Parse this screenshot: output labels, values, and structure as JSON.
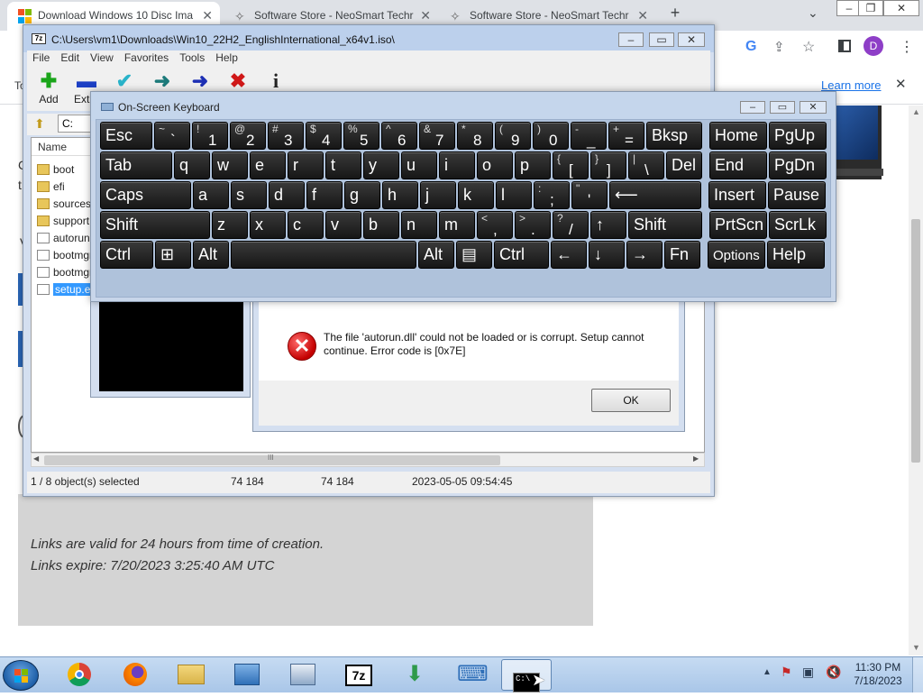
{
  "browser": {
    "tabs": [
      {
        "title": "Download Windows 10 Disc Ima",
        "active": true
      },
      {
        "title": "Software Store - NeoSmart Techr",
        "active": false
      },
      {
        "title": "Software Store - NeoSmart Techr",
        "active": false
      }
    ],
    "close_glyph": "✕",
    "new_tab_glyph": "+",
    "tab_search_glyph": "⌄",
    "profile_initial": "D",
    "infobar_link": "Learn more",
    "infobar_close": "✕",
    "infobar_text_fragment": "To",
    "page_fragments": [
      "C",
      "t",
      "V"
    ],
    "links_valid": "Links are valid for 24 hours from time of creation.",
    "links_expire": "Links expire: 7/20/2023 3:25:40 AM UTC"
  },
  "sevenzip": {
    "title": "C:\\Users\\vm1\\Downloads\\Win10_22H2_EnglishInternational_x64v1.iso\\",
    "app_icon": "7z",
    "menu": [
      "File",
      "Edit",
      "View",
      "Favorites",
      "Tools",
      "Help"
    ],
    "toolbar": [
      {
        "label": "Add",
        "icon": "plus-icon",
        "glyph": "✚",
        "color": "#1aa51a"
      },
      {
        "label": "Extra",
        "icon": "minus-icon",
        "glyph": "▬",
        "color": "#1c3fc4"
      },
      {
        "label": "",
        "icon": "check-icon",
        "glyph": "✔",
        "color": "#29b3c9"
      },
      {
        "label": "",
        "icon": "copy-arrow-icon",
        "glyph": "➜",
        "color": "#1c7a7a"
      },
      {
        "label": "",
        "icon": "move-arrow-icon",
        "glyph": "➜",
        "color": "#1c2fb4"
      },
      {
        "label": "",
        "icon": "delete-x-icon",
        "glyph": "✖",
        "color": "#d01818"
      },
      {
        "label": "",
        "icon": "info-icon",
        "glyph": "i",
        "color": "#222222"
      }
    ],
    "address_fragment": "C:",
    "column_name": "Name",
    "files": [
      {
        "name": "boot",
        "type": "folder"
      },
      {
        "name": "efi",
        "type": "folder"
      },
      {
        "name": "sources",
        "type": "folder"
      },
      {
        "name": "support",
        "type": "folder"
      },
      {
        "name": "autorun",
        "type": "file"
      },
      {
        "name": "bootmgr",
        "type": "file"
      },
      {
        "name": "bootmgr",
        "type": "file"
      },
      {
        "name": "setup.exe",
        "type": "file",
        "selected": true
      }
    ],
    "status": {
      "selected": "1 / 8 object(s) selected",
      "size": "74 184",
      "packed": "74 184",
      "modified": "2023-05-05 09:54:45"
    },
    "hscroll_glyph": "III"
  },
  "osk": {
    "title": "On-Screen Keyboard",
    "rows": [
      [
        {
          "label": "Esc",
          "w": 58
        },
        {
          "top": "~",
          "bottom": "`",
          "w": 40
        },
        {
          "top": "!",
          "bottom": "1",
          "w": 40
        },
        {
          "top": "@",
          "bottom": "2",
          "w": 40
        },
        {
          "top": "#",
          "bottom": "3",
          "w": 40
        },
        {
          "top": "$",
          "bottom": "4",
          "w": 40
        },
        {
          "top": "%",
          "bottom": "5",
          "w": 40
        },
        {
          "top": "^",
          "bottom": "6",
          "w": 40
        },
        {
          "top": "&",
          "bottom": "7",
          "w": 40
        },
        {
          "top": "*",
          "bottom": "8",
          "w": 40
        },
        {
          "top": "(",
          "bottom": "9",
          "w": 40
        },
        {
          "top": ")",
          "bottom": "0",
          "w": 40
        },
        {
          "top": "-",
          "bottom": "_",
          "w": 40
        },
        {
          "top": "+",
          "bottom": "=",
          "w": 40
        },
        {
          "label": "Bksp",
          "w": 62
        },
        {
          "label": "Home",
          "w": 64,
          "gap": 6
        },
        {
          "label": "PgUp",
          "w": 64
        }
      ],
      [
        {
          "label": "Tab",
          "w": 80
        },
        {
          "label": "q",
          "w": 40
        },
        {
          "label": "w",
          "w": 40
        },
        {
          "label": "e",
          "w": 40
        },
        {
          "label": "r",
          "w": 40
        },
        {
          "label": "t",
          "w": 40
        },
        {
          "label": "y",
          "w": 40
        },
        {
          "label": "u",
          "w": 40
        },
        {
          "label": "i",
          "w": 40
        },
        {
          "label": "o",
          "w": 40
        },
        {
          "label": "p",
          "w": 40
        },
        {
          "top": "{",
          "bottom": "[",
          "w": 40
        },
        {
          "top": "}",
          "bottom": "]",
          "w": 40
        },
        {
          "top": "|",
          "bottom": "\\",
          "w": 40
        },
        {
          "label": "Del",
          "w": 40
        },
        {
          "label": "End",
          "w": 64,
          "gap": 6
        },
        {
          "label": "PgDn",
          "w": 64
        }
      ],
      [
        {
          "label": "Caps",
          "w": 101
        },
        {
          "label": "a",
          "w": 40
        },
        {
          "label": "s",
          "w": 40
        },
        {
          "label": "d",
          "w": 40
        },
        {
          "label": "f",
          "w": 40
        },
        {
          "label": "g",
          "w": 40
        },
        {
          "label": "h",
          "w": 40
        },
        {
          "label": "j",
          "w": 40
        },
        {
          "label": "k",
          "w": 40
        },
        {
          "label": "l",
          "w": 40
        },
        {
          "top": ":",
          "bottom": ";",
          "w": 40
        },
        {
          "top": "\"",
          "bottom": "'",
          "w": 40
        },
        {
          "label": "⟵",
          "w": 102
        },
        {
          "label": "Insert",
          "w": 64,
          "gap": 6
        },
        {
          "label": "Pause",
          "w": 64
        }
      ],
      [
        {
          "label": "Shift",
          "w": 122
        },
        {
          "label": "z",
          "w": 40
        },
        {
          "label": "x",
          "w": 40
        },
        {
          "label": "c",
          "w": 40
        },
        {
          "label": "v",
          "w": 40
        },
        {
          "label": "b",
          "w": 40
        },
        {
          "label": "n",
          "w": 40
        },
        {
          "label": "m",
          "w": 40
        },
        {
          "top": "<",
          "bottom": ",",
          "w": 40
        },
        {
          "top": ">",
          "bottom": ".",
          "w": 40
        },
        {
          "top": "?",
          "bottom": "/",
          "w": 40
        },
        {
          "label": "↑",
          "w": 40
        },
        {
          "label": "Shift",
          "w": 82
        },
        {
          "label": "PrtScn",
          "w": 64,
          "gap": 6
        },
        {
          "label": "ScrLk",
          "w": 64
        }
      ],
      [
        {
          "label": "Ctrl",
          "w": 59
        },
        {
          "label": "⊞",
          "w": 40
        },
        {
          "label": "Alt",
          "w": 40
        },
        {
          "label": "",
          "w": 206
        },
        {
          "label": "Alt",
          "w": 40
        },
        {
          "label": "▤",
          "w": 40
        },
        {
          "label": "Ctrl",
          "w": 61
        },
        {
          "label": "←",
          "w": 40
        },
        {
          "label": "↓",
          "w": 40
        },
        {
          "label": "→",
          "w": 40
        },
        {
          "label": "Fn",
          "w": 40
        },
        {
          "label": "Options",
          "w": 64,
          "gap": 6,
          "small": true
        },
        {
          "label": "Help",
          "w": 64
        }
      ]
    ]
  },
  "dialog": {
    "message": "The file 'autorun.dll' could not be loaded or is corrupt. Setup cannot continue. Error code is [0x7E]",
    "ok_label": "OK",
    "icon_glyph": "✕"
  },
  "taskbar": {
    "apps": [
      {
        "name": "chrome",
        "glyph": "◉",
        "color": "#d93025"
      },
      {
        "name": "firefox",
        "glyph": "◐",
        "color": "#e66000"
      },
      {
        "name": "explorer",
        "glyph": "▭",
        "color": "#d9b44a"
      },
      {
        "name": "control-panel",
        "glyph": "▦",
        "color": "#2f6fb8"
      },
      {
        "name": "computer-setup",
        "glyph": "▣",
        "color": "#2f6fb8"
      },
      {
        "name": "7zip",
        "glyph": "7z",
        "color": "#000000"
      },
      {
        "name": "downloader",
        "glyph": "⬇",
        "color": "#2f9a4b"
      },
      {
        "name": "keyboard",
        "glyph": "⌨",
        "color": "#2f6fb8"
      },
      {
        "name": "cmd",
        "glyph": "C:\\",
        "color": "#000000",
        "active": true
      }
    ],
    "tray_chevron": "▲",
    "time": "11:30 PM",
    "date": "7/18/2023"
  }
}
